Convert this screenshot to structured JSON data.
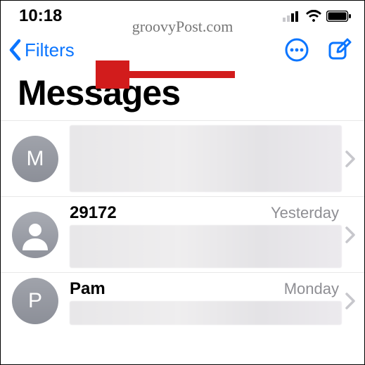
{
  "status": {
    "time": "10:18"
  },
  "watermark": "groovyPost.com",
  "nav": {
    "back_label": "Filters"
  },
  "title": "Messages",
  "rows": [
    {
      "avatar_type": "letter",
      "avatar_letter": "M",
      "sender": "",
      "time": ""
    },
    {
      "avatar_type": "silhouette",
      "avatar_letter": "",
      "sender": "29172",
      "time": "Yesterday"
    },
    {
      "avatar_type": "letter",
      "avatar_letter": "P",
      "sender": "Pam",
      "time": "Monday"
    }
  ]
}
